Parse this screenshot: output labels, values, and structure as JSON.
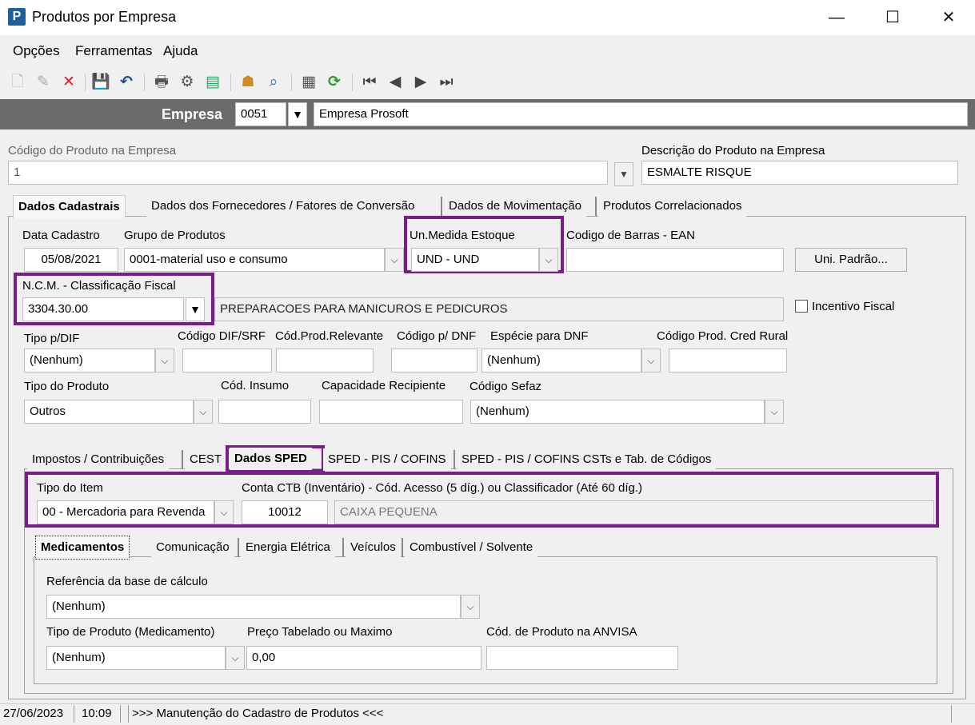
{
  "window": {
    "title": "Produtos por Empresa",
    "minimize": "—",
    "maximize": "☐",
    "close": "✕"
  },
  "menu": {
    "items": [
      "Opções",
      "Ferramentas",
      "Ajuda"
    ]
  },
  "empresa": {
    "label": "Empresa",
    "code": "0051",
    "name": "Empresa Prosoft"
  },
  "product": {
    "code_label": "Código do Produto na Empresa",
    "code": "1",
    "desc_label": "Descrição do Produto na Empresa",
    "desc": "ESMALTE RISQUE"
  },
  "tabs": [
    "Dados Cadastrais",
    "Dados dos Fornecedores / Fatores de Conversão",
    "Dados de Movimentação",
    "Produtos Correlacionados"
  ],
  "cadastro": {
    "data_label": "Data Cadastro",
    "data": "05/08/2021",
    "grupo_label": "Grupo de Produtos",
    "grupo": "0001-material uso e consumo",
    "unmed_label": "Un.Medida Estoque",
    "unmed": "UND - UND",
    "ean_label": "Codigo de Barras - EAN",
    "ean": "",
    "uni_padrao_button": "Uni. Padrão...",
    "ncm_label": "N.C.M. -  Classificação Fiscal",
    "ncm": "3304.30.00",
    "ncm_desc": "PREPARACOES PARA MANICUROS E PEDICUROS",
    "incentivo_label": "Incentivo Fiscal",
    "tipo_dif_label": "Tipo p/DIF",
    "tipo_dif": "(Nenhum)",
    "cod_dif_label": "Código DIF/SRF",
    "cod_prod_rel_label": "Cód.Prod.Relevante",
    "cod_dnf_label": "Código p/ DNF",
    "especie_dnf_label": "Espécie para DNF",
    "especie_dnf": "(Nenhum)",
    "cod_cred_rural_label": "Código Prod. Cred Rural",
    "tipo_prod_label": "Tipo do Produto",
    "tipo_prod": "Outros",
    "cod_insumo_label": "Cód. Insumo",
    "cap_recip_label": "Capacidade Recipiente",
    "cod_sefaz_label": "Código Sefaz",
    "cod_sefaz": "(Nenhum)"
  },
  "subtabs": [
    "Impostos / Contribuições",
    "CEST",
    "Dados SPED",
    "SPED - PIS / COFINS",
    "SPED - PIS / COFINS CSTs e Tab. de Códigos"
  ],
  "sped": {
    "tipo_item_label": "Tipo do Item",
    "tipo_item": "00 - Mercadoria para Revenda",
    "conta_label": "Conta CTB (Inventário) - Cód. Acesso (5 díg.) ou Classificador (Até 60 díg.)",
    "conta_code": "10012",
    "conta_desc": "CAIXA PEQUENA"
  },
  "subsubtabs": [
    "Medicamentos",
    "Comunicação",
    "Energia Elétrica",
    "Veículos",
    "Combustível / Solvente"
  ],
  "medicamentos": {
    "ref_label": "Referência da base de cálculo",
    "ref": "(Nenhum)",
    "tipo_label": "Tipo de Produto (Medicamento)",
    "tipo": "(Nenhum)",
    "preco_label": "Preço Tabelado ou Maximo",
    "preco": "0,00",
    "anvisa_label": "Cód. de Produto na ANVISA",
    "anvisa": ""
  },
  "status": {
    "date": "27/06/2023",
    "time": "10:09",
    "message": ">>> Manutenção do Cadastro de Produtos <<<"
  }
}
